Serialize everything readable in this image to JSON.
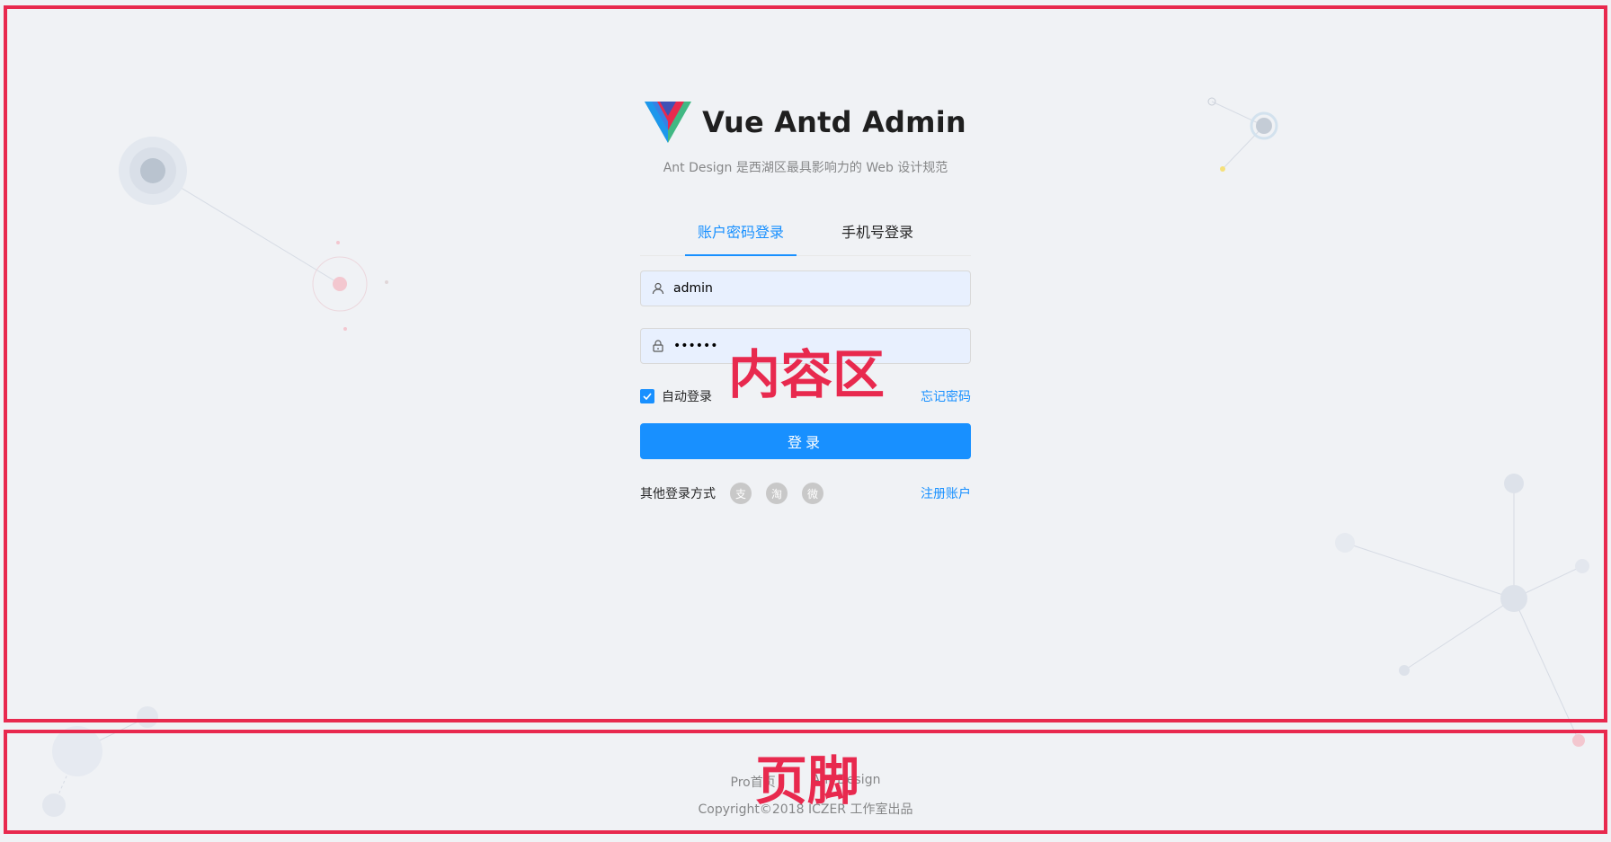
{
  "brand": {
    "title": "Vue Antd Admin",
    "description": "Ant Design 是西湖区最具影响力的 Web 设计规范"
  },
  "tabs": [
    {
      "label": "账户密码登录",
      "active": true
    },
    {
      "label": "手机号登录",
      "active": false
    }
  ],
  "form": {
    "username_value": "admin",
    "password_value": "••••••",
    "remember_label": "自动登录",
    "remember_checked": true,
    "forgot_label": "忘记密码",
    "submit_label": "登录"
  },
  "other_login": {
    "label": "其他登录方式",
    "icons": [
      "alipay-icon",
      "taobao-icon",
      "weibo-icon"
    ],
    "register_label": "注册账户"
  },
  "footer": {
    "links": [
      "Pro首页",
      "Ant Design"
    ],
    "copyright": "Copyright©2018 ICZER 工作室出品"
  },
  "annotations": {
    "content_label": "内容区",
    "footer_label": "页脚"
  },
  "colors": {
    "primary": "#1890ff",
    "annotation": "#e8294e",
    "background": "#f0f2f5"
  }
}
